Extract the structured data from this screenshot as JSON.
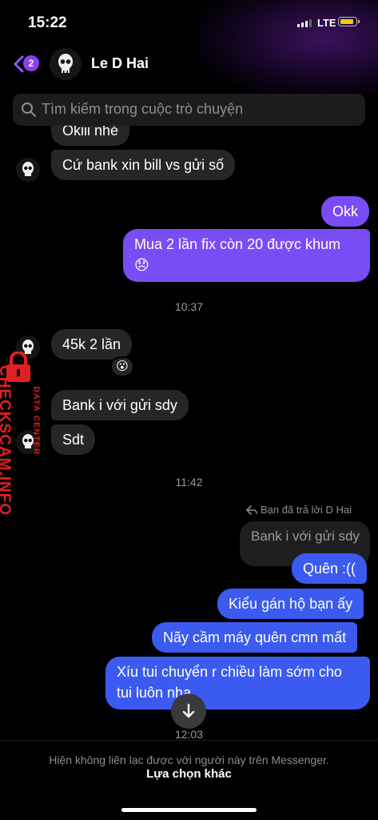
{
  "status_bar": {
    "time": "15:22",
    "network": "LTE"
  },
  "header": {
    "unread_count": "2",
    "contact_name": "Le D Hai"
  },
  "search": {
    "placeholder": "Tìm kiếm trong cuộc trò chuyện"
  },
  "messages": {
    "partial_top": "Okiii nhé",
    "m1": "Cứ bank xin bill vs gửi số",
    "m2": "Okk",
    "m3_line1": "Mua 2 lần fix còn 20 được khum",
    "m3_line2": "😞",
    "time1": "10:37",
    "m4": "45k 2 lần",
    "m4_reaction": "😮",
    "m5": "Bank i với gửi sdy",
    "m6": "Sdt",
    "time2": "11:42",
    "reply_label": "Bạn đã trả lời D Hai",
    "reply_quote": "Bank i với gửi sdy",
    "m7": "Quên :((",
    "m8": "Kiểu gán hộ bạn ấy",
    "m9": "Nãy cầm máy quên cmn mất",
    "m10_line1": "Xíu tui chuyển r chiều làm sớm cho",
    "m10_line2": "tui luôn nha",
    "time3": "12:03"
  },
  "watermark": {
    "main": "CHECKSCAM.INFO",
    "sub": "DATA CENTER"
  },
  "footer": {
    "notice": "Hiện không liên lạc được với người này trên Messenger.",
    "link": "Lựa chọn khác"
  },
  "colors": {
    "accent_purple": "#7a4cf5",
    "accent_blue": "#3b5bf0",
    "incoming_bubble": "#262628",
    "badge": "#8b3df0",
    "watermark_red": "#e02020"
  }
}
